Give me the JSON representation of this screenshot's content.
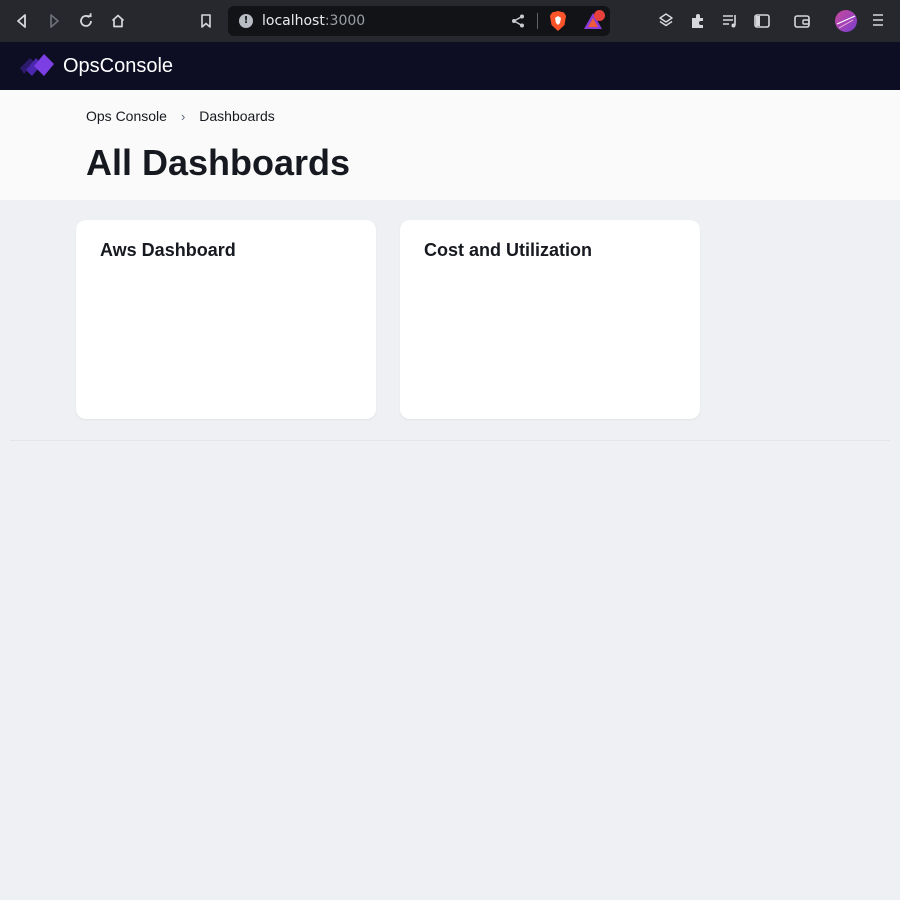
{
  "browser": {
    "url_host": "localhost",
    "url_port": ":3000"
  },
  "app": {
    "name": "OpsConsole",
    "brand_color": "#7b3fe4",
    "header_bg": "#0d0e24"
  },
  "breadcrumb": {
    "items": [
      "Ops Console",
      "Dashboards"
    ],
    "separator": "›"
  },
  "page": {
    "title": "All Dashboards"
  },
  "dashboards": [
    {
      "title": "Aws Dashboard"
    },
    {
      "title": "Cost and Utilization"
    }
  ],
  "icons": {
    "toolbar": [
      "back-icon",
      "forward-icon",
      "reload-icon",
      "home-icon",
      "bookmark-icon",
      "info-icon",
      "share-icon",
      "brave-shields-icon",
      "brave-rewards-icon",
      "leo-icon",
      "extensions-icon",
      "playlist-icon",
      "sidebar-icon",
      "wallet-icon",
      "profile-avatar",
      "menu-icon"
    ]
  }
}
